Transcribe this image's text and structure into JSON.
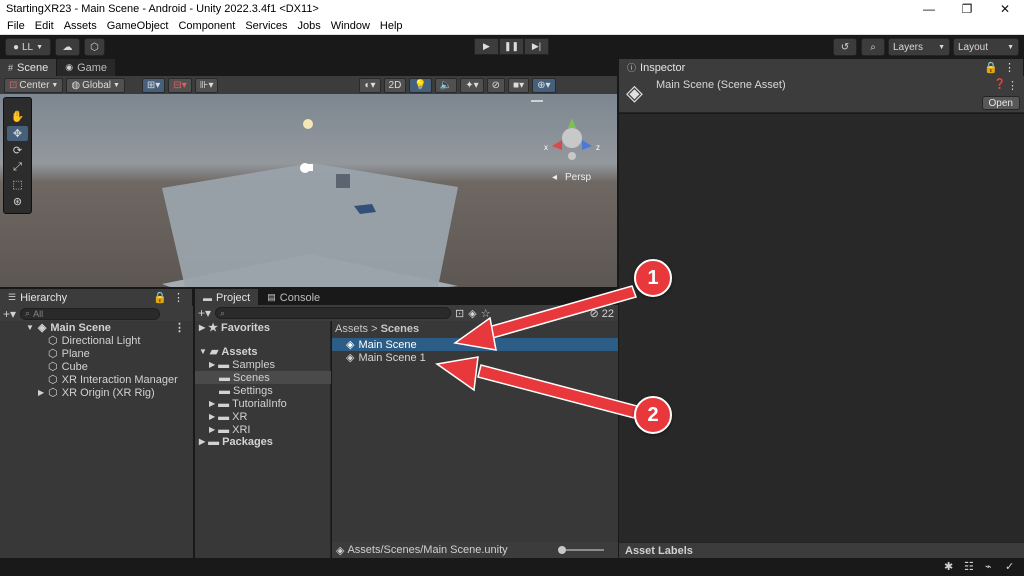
{
  "window": {
    "title": "StartingXR23 - Main Scene - Android - Unity 2022.3.4f1 <DX11>",
    "minimize": "—",
    "maximize": "❐",
    "close": "✕"
  },
  "menu": [
    "File",
    "Edit",
    "Assets",
    "GameObject",
    "Component",
    "Services",
    "Jobs",
    "Window",
    "Help"
  ],
  "toolbar": {
    "account": "LL",
    "layers": "Layers",
    "layout": "Layout"
  },
  "scene": {
    "tabs": [
      {
        "label": "Scene",
        "icon": "grid-icon"
      },
      {
        "label": "Game",
        "icon": "gamepad-icon"
      }
    ],
    "pivot": "Center",
    "space": "Global",
    "mode_2d": "2D",
    "projection": "Persp",
    "gizmo_axes": {
      "x": "x",
      "z": "z"
    }
  },
  "hierarchy": {
    "tab": "Hierarchy",
    "search_placeholder": "All",
    "scene_name": "Main Scene",
    "items": [
      "Directional Light",
      "Plane",
      "Cube",
      "XR Interaction Manager",
      "XR Origin (XR Rig)"
    ]
  },
  "project": {
    "tabs": [
      "Project",
      "Console"
    ],
    "hidden_count": "22",
    "favorites": "Favorites",
    "assets": "Assets",
    "asset_folders": [
      "Samples",
      "Scenes",
      "Settings",
      "TutorialInfo",
      "XR",
      "XRI"
    ],
    "packages": "Packages",
    "breadcrumb": {
      "root": "Assets",
      "current": "Scenes"
    },
    "files": [
      "Main Scene",
      "Main Scene 1"
    ],
    "status_path": "Assets/Scenes/Main Scene.unity"
  },
  "inspector": {
    "tab": "Inspector",
    "title": "Main Scene (Scene Asset)",
    "open_button": "Open",
    "footer": "Asset Labels"
  },
  "annotations": {
    "badge1": "1",
    "badge2": "2"
  },
  "colors": {
    "selection": "#2c5d87",
    "annotation": "#e8383b",
    "panel": "#383838",
    "accent_blue": "#46607c"
  }
}
